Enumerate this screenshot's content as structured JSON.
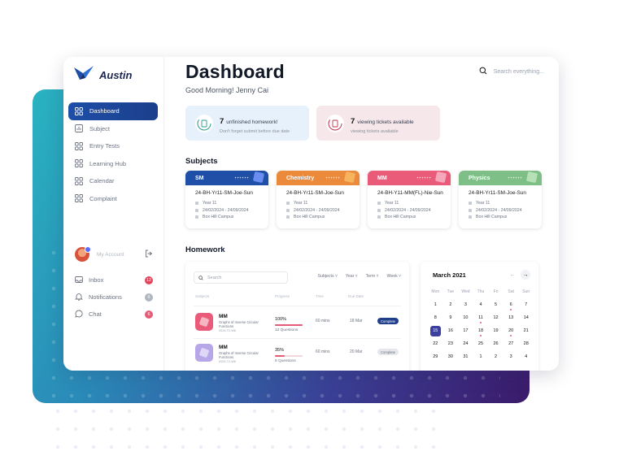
{
  "app": {
    "logo_text": "Austin"
  },
  "sidebar": {
    "items": [
      {
        "label": "Dashboard",
        "icon": "grid-icon",
        "active": true
      },
      {
        "label": "Subject",
        "icon": "chart-icon"
      },
      {
        "label": "Entry Tests",
        "icon": "grid-icon"
      },
      {
        "label": "Learning Hub",
        "icon": "grid-icon"
      },
      {
        "label": "Calendar",
        "icon": "grid-icon"
      },
      {
        "label": "Complaint",
        "icon": "grid-icon"
      }
    ],
    "account_label": "My Account",
    "bottom": [
      {
        "label": "Inbox",
        "icon": "inbox-icon",
        "count": "12",
        "color": "#e2455b"
      },
      {
        "label": "Notifications",
        "icon": "bell-icon",
        "count": "6",
        "color": "#b0b6c0"
      },
      {
        "label": "Chat",
        "icon": "chat-icon",
        "count": "6",
        "color": "#e55b76"
      }
    ]
  },
  "header": {
    "title": "Dashboard",
    "greeting": "Good Morning! Jenny Cai",
    "search_placeholder": "Search everything..."
  },
  "stats": [
    {
      "number": "7",
      "title": "unfinished homework!",
      "subtitle": "Don't forget submit before due date",
      "bg": "#e7f1fc",
      "accent": "#2b9a8c"
    },
    {
      "number": "7",
      "title": "viewing tickets available",
      "subtitle": "viewing tickets available",
      "bg": "#f6e7ea",
      "accent": "#c2334f"
    }
  ],
  "subjects": {
    "title": "Subjects",
    "cards": [
      {
        "name": "SM",
        "code": "24-BH-Yr11-SM-Joe-Sun",
        "year": "Year 11",
        "dates": "24/02/2024 - 24/09/2024",
        "campus": "Box Hill Campus",
        "color": "#1f4fa6",
        "cube": "#6a8df0"
      },
      {
        "name": "Chemistry",
        "code": "24-BH-Yr11-SM-Joe-Sun",
        "year": "Year 11",
        "dates": "24/02/2024 - 24/09/2024",
        "campus": "Box Hill Campus",
        "color": "#ec8a3c",
        "cube": "#f6b45e"
      },
      {
        "name": "MM",
        "code": "24-BH-Y11-MM(FL)-Nie-Sun",
        "year": "Year 11",
        "dates": "24/02/2024 - 24/09/2024",
        "campus": "Box Hill Campus",
        "color": "#ea5b7a",
        "cube": "#f6a8bb"
      },
      {
        "name": "Physics",
        "code": "24-BH-Yr11-SM-Joe-Sun",
        "year": "Year 11",
        "dates": "24/02/2024 - 24/09/2024",
        "campus": "Box Hill Campus",
        "color": "#7dbf86",
        "cube": "#b6e0b5"
      }
    ]
  },
  "homework": {
    "title": "Homework",
    "search_placeholder": "Search",
    "filters": [
      "Subjects",
      "Year",
      "Term",
      "Week"
    ],
    "columns": [
      "Subjects",
      "Progress",
      "Time",
      "Due Date"
    ],
    "rows": [
      {
        "name": "MM",
        "desc": "Graphs of Inverse Circular Functions",
        "code": "2024-T2-W6",
        "progress": "100%",
        "progress_value": 100,
        "questions": "12 Questions",
        "time": "60 mins",
        "due": "18 Mar",
        "status": "Complete",
        "status_bg": "#1f3f8a",
        "status_fg": "#ffffff",
        "thumb": "#ea5b7a"
      },
      {
        "name": "MM",
        "desc": "Graphs of Inverse Circular Functions",
        "code": "2024-T2-W6",
        "progress": "35%",
        "progress_value": 35,
        "questions": "8 Questions",
        "time": "60 mins",
        "due": "20 Mar",
        "status": "Complete",
        "status_bg": "#e5e7eb",
        "status_fg": "#6b7280",
        "thumb": "#b7a6e8"
      }
    ]
  },
  "calendar": {
    "title": "March 2021",
    "prev_icon": "arrow-left-icon",
    "next_icon": "arrow-right-icon",
    "weekdays": [
      "Mon",
      "Tue",
      "Wed",
      "Thu",
      "Fri",
      "Sat",
      "Sun"
    ],
    "weeks": [
      [
        "",
        "",
        "",
        "",
        "",
        "",
        ""
      ],
      [
        "1",
        "2",
        "3",
        "4",
        "5",
        "6",
        "7"
      ],
      [
        "8",
        "9",
        "10",
        "11",
        "12",
        "13",
        "14"
      ],
      [
        "15",
        "16",
        "17",
        "18",
        "19",
        "20",
        "21"
      ],
      [
        "22",
        "23",
        "24",
        "25",
        "26",
        "27",
        "28"
      ],
      [
        "29",
        "30",
        "31",
        "1",
        "2",
        "3",
        "4"
      ]
    ],
    "selected": "15",
    "marked": [
      "6",
      "11",
      "18",
      "20"
    ]
  }
}
